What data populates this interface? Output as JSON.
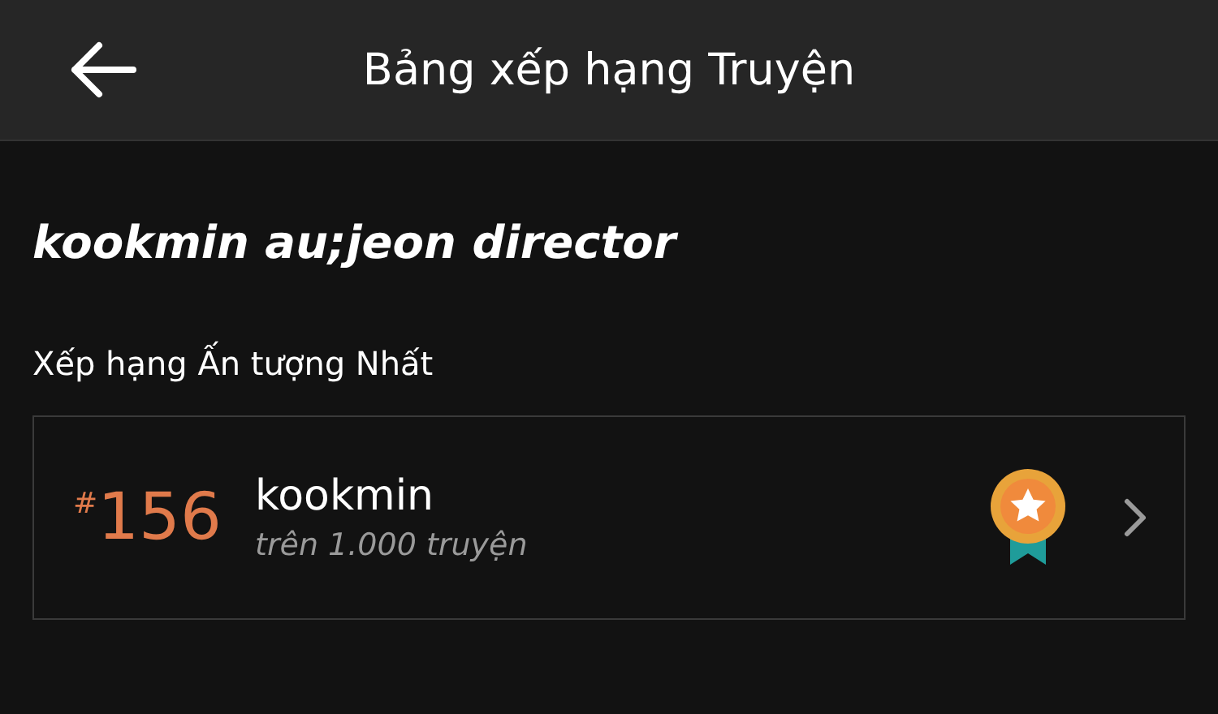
{
  "header": {
    "title": "Bảng xếp hạng Truyện"
  },
  "story_title": "kookmin au;jeon director",
  "section_label": "Xếp hạng Ấn tượng Nhất",
  "rankings": [
    {
      "rank": "$^{#}$156",
      "tag": "kookmin",
      "subtitle": "trên 1.000 truyện"
    }
  ]
}
